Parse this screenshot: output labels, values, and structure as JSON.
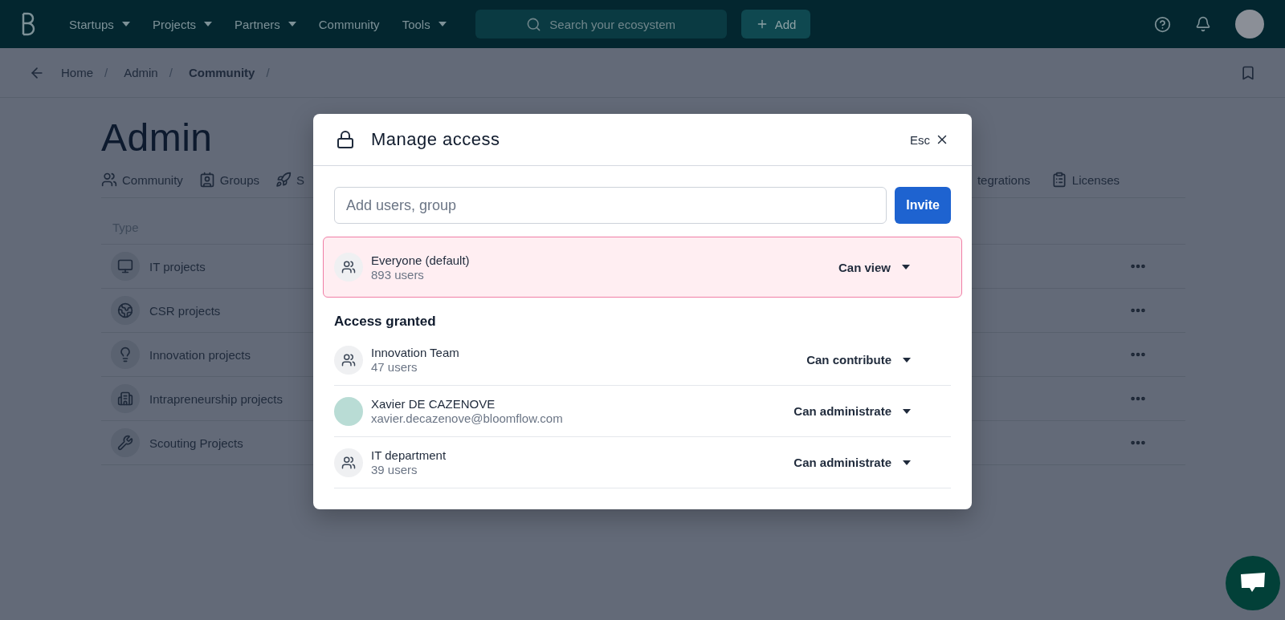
{
  "nav": {
    "menu": [
      {
        "label": "Startups",
        "has_dropdown": true
      },
      {
        "label": "Projects",
        "has_dropdown": true
      },
      {
        "label": "Partners",
        "has_dropdown": true
      },
      {
        "label": "Community",
        "has_dropdown": false
      },
      {
        "label": "Tools",
        "has_dropdown": true
      }
    ],
    "search": {
      "placeholder": "Search your ecosystem"
    },
    "add_button": "Add"
  },
  "breadcrumb": [
    {
      "label": "Home",
      "separator": "/",
      "current": false
    },
    {
      "label": "Admin",
      "separator": "/",
      "current": false
    },
    {
      "label": "Community",
      "separator": "/",
      "current": true
    }
  ],
  "page": {
    "title": "Admin",
    "tabs": [
      {
        "label": "Community",
        "kind": "community"
      },
      {
        "label": "Groups",
        "kind": "groups"
      },
      {
        "label": "S",
        "kind": "rocket"
      },
      {
        "label": "tegrations",
        "kind": "plain"
      },
      {
        "label": "Licenses",
        "kind": "licenses"
      }
    ],
    "table": {
      "columns": [
        "Type"
      ],
      "rows": [
        {
          "label": "IT projects",
          "kind": "monitor"
        },
        {
          "label": "CSR projects",
          "kind": "globe"
        },
        {
          "label": "Innovation projects",
          "kind": "bulb"
        },
        {
          "label": "Intrapreneurship projects",
          "kind": "building"
        },
        {
          "label": "Scouting Projects",
          "kind": "wrench"
        }
      ]
    }
  },
  "modal": {
    "title": "Manage access",
    "close_label": "Esc",
    "input": {
      "placeholder": "Add users, group"
    },
    "invite_button": "Invite",
    "default_entry": {
      "name": "Everyone (default)",
      "detail": "893 users",
      "permission": "Can view",
      "kind": "everyone",
      "highlighted": true
    },
    "section_title": "Access granted",
    "entries": [
      {
        "name": "Innovation Team",
        "detail": "47 users",
        "permission": "Can contribute",
        "kind": "group"
      },
      {
        "name": "Xavier DE CAZENOVE",
        "detail": "xavier.decazenove@bloomflow.com",
        "permission": "Can administrate",
        "kind": "person"
      },
      {
        "name": "IT department",
        "detail": "39 users",
        "permission": "Can administrate",
        "kind": "group"
      }
    ]
  }
}
